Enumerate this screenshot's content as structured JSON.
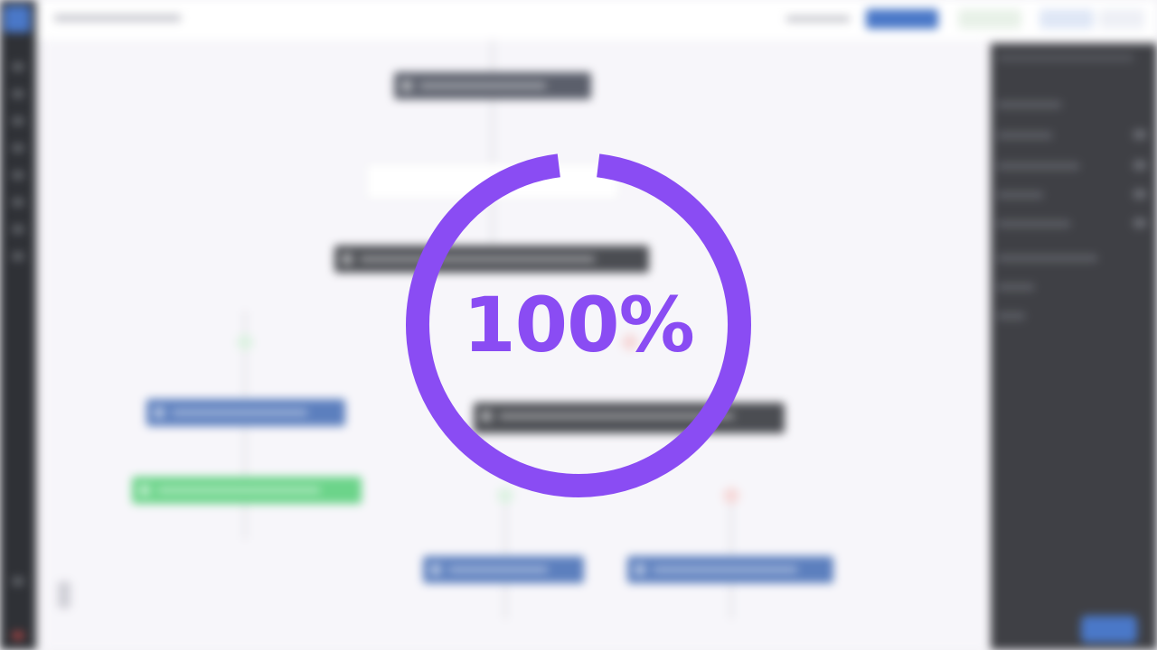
{
  "loader": {
    "progress_label": "100%",
    "progress_value": 100,
    "ring_color": "#8a4cf3"
  },
  "background": {
    "blurred": true,
    "accent_color": "#4a78c8",
    "nodes": [
      {
        "kind": "gray"
      },
      {
        "kind": "white"
      },
      {
        "kind": "dark"
      },
      {
        "kind": "blue"
      },
      {
        "kind": "dark"
      },
      {
        "kind": "green"
      },
      {
        "kind": "blue"
      },
      {
        "kind": "blue"
      }
    ],
    "icons": [
      "app-logo-icon",
      "close-icon",
      "settings-icon"
    ]
  }
}
